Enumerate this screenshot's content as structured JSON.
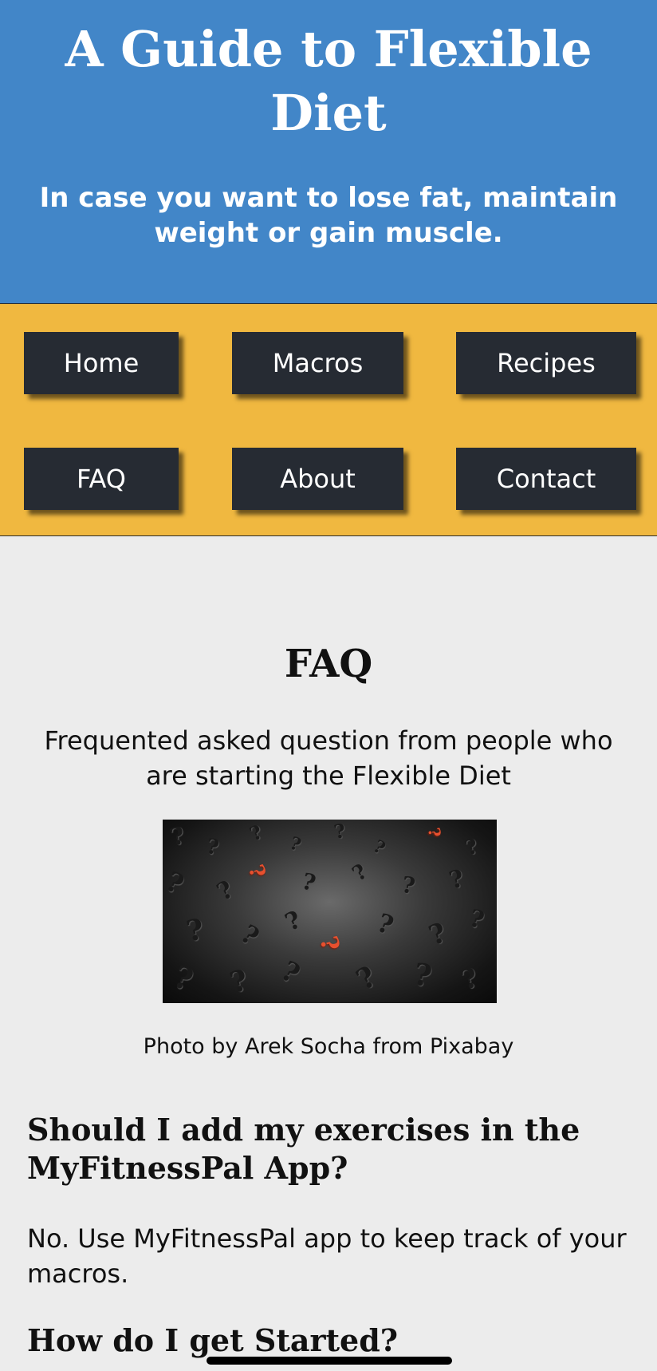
{
  "header": {
    "title": "A Guide to Flexible Diet",
    "subtitle": "In case you want to lose fat, maintain weight or gain muscle."
  },
  "nav": {
    "items": [
      {
        "label": "Home"
      },
      {
        "label": "Macros"
      },
      {
        "label": "Recipes"
      },
      {
        "label": "FAQ"
      },
      {
        "label": "About"
      },
      {
        "label": "Contact"
      }
    ]
  },
  "main": {
    "title": "FAQ",
    "intro": "Frequented asked question from people who are starting the Flexible Diet",
    "photo_caption": "Photo by Arek Socha from Pixabay",
    "faqs": [
      {
        "question": "Should I add my exercises in the MyFitnessPal App?",
        "answer": "No. Use MyFitnessPal app to keep track of your macros."
      },
      {
        "question": "How do I get Started?"
      }
    ]
  },
  "colors": {
    "header_bg": "#4286c8",
    "nav_bg": "#f0b840",
    "nav_button_bg": "#262b33",
    "page_bg": "#ececec"
  }
}
